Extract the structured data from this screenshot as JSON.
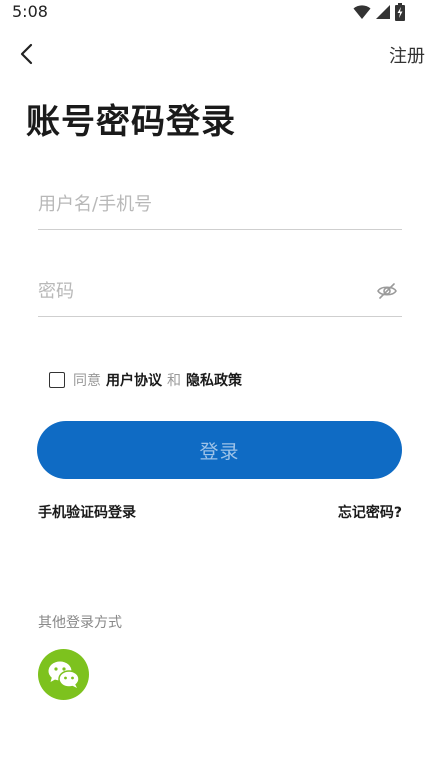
{
  "status_bar": {
    "time": "5:08",
    "icons": [
      "wifi-icon",
      "cell-signal-icon",
      "battery-charging-icon"
    ]
  },
  "header": {
    "back_icon": "chevron-left-icon",
    "register_label": "注册"
  },
  "title": "账号密码登录",
  "form": {
    "username_placeholder": "用户名/手机号",
    "username_value": "",
    "password_placeholder": "密码",
    "password_value": "",
    "password_visibility_icon": "eye-off-icon"
  },
  "agreement": {
    "checked": false,
    "prefix": "同意",
    "user_agreement": "用户协议",
    "and": "和",
    "privacy_policy": "隐私政策"
  },
  "login_button": "登录",
  "sms_login": "手机验证码登录",
  "forgot_password": "忘记密码?",
  "other_login": {
    "label": "其他登录方式",
    "methods": [
      "wechat-icon"
    ]
  },
  "colors": {
    "primary": "#0f6bc4",
    "button_text": "#9ec3e8",
    "wechat": "#7dc21e",
    "divider": "#cfcfcf",
    "placeholder": "#b8b8b8"
  }
}
